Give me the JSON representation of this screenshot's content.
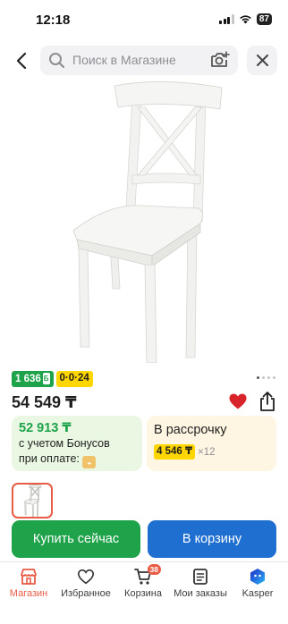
{
  "status_bar": {
    "time": "12:18",
    "battery": "87"
  },
  "search": {
    "placeholder": "Поиск в Магазине"
  },
  "product": {
    "price": "54 549 ₸",
    "badges": {
      "bonus": "1 636",
      "bonus_icon": "Б",
      "installment": "0·0·24"
    }
  },
  "bonus_card": {
    "amount": "52 913 ₸",
    "line1": "с учетом Бонусов",
    "line2": "при оплате:"
  },
  "installment_card": {
    "title": "В рассрочку",
    "amount": "4 546 ₸",
    "multiplier": "×12"
  },
  "actions": {
    "buy_now": "Купить сейчас",
    "add_to_cart": "В корзину"
  },
  "tabbar": {
    "items": [
      {
        "label": "Магазин",
        "icon": "shop-icon"
      },
      {
        "label": "Избранное",
        "icon": "heart-icon"
      },
      {
        "label": "Корзина",
        "icon": "cart-icon",
        "badge": "38"
      },
      {
        "label": "Мои заказы",
        "icon": "orders-icon"
      },
      {
        "label": "Kasper",
        "icon": "kasper-icon"
      }
    ]
  },
  "colors": {
    "accent_red": "#e85b45",
    "green": "#1fa34a",
    "blue": "#1f6fd1",
    "yellow": "#ffd600"
  }
}
